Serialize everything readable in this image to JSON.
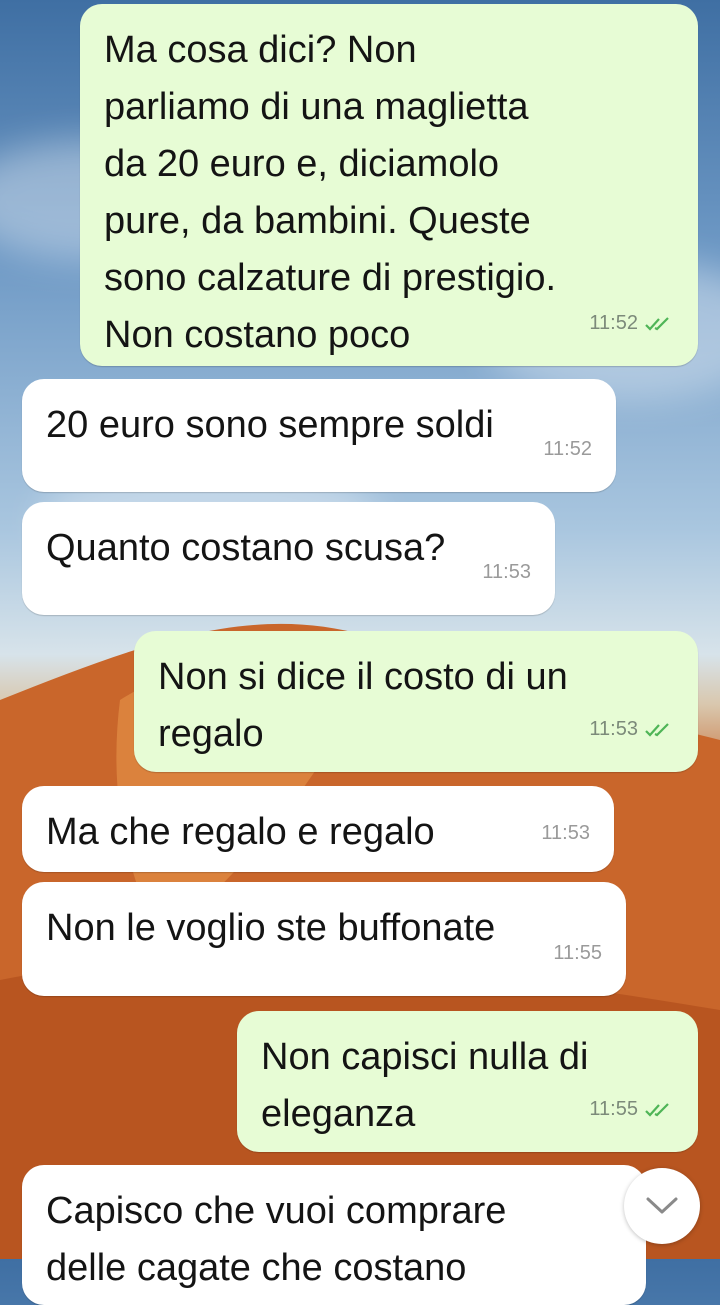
{
  "messages": [
    {
      "dir": "out",
      "text": "Ma cosa dici? Non\nparliamo di una maglietta\nda 20 euro e, diciamolo\npure, da bambini. Queste\nsono calzature di prestigio.\nNon costano poco",
      "time": "11:52",
      "read": true
    },
    {
      "dir": "in",
      "text": "20 euro sono sempre soldi",
      "time": "11:52"
    },
    {
      "dir": "in",
      "text": "Quanto costano scusa?",
      "time": "11:53"
    },
    {
      "dir": "out",
      "text": "Non si dice il costo di un\nregalo",
      "time": "11:53",
      "read": true
    },
    {
      "dir": "in",
      "text": "Ma che regalo e regalo",
      "time": "11:53"
    },
    {
      "dir": "in",
      "text": "Non le voglio ste buffonate",
      "time": "11:55"
    },
    {
      "dir": "out",
      "text": "Non capisci nulla di\neleganza",
      "time": "11:55",
      "read": true
    },
    {
      "dir": "in",
      "text": "Capisco che vuoi comprare\ndelle cagate che costano",
      "time": ""
    }
  ],
  "colors": {
    "outgoing_bubble": "#e7fcd5",
    "incoming_bubble": "#ffffff",
    "read_tick": "#4fb557"
  },
  "icons": {
    "read_receipt": "double-check-icon",
    "scroll_down": "chevron-down-icon"
  }
}
